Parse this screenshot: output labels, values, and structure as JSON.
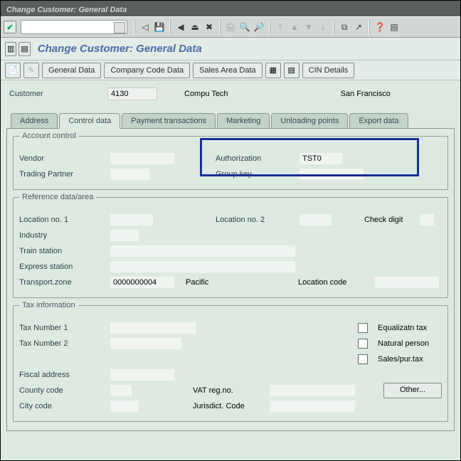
{
  "window": {
    "title": "Change Customer: General Data",
    "page_title": "Change Customer: General Data"
  },
  "toolbar": {
    "buttons": {
      "general_data": "General Data",
      "company_code_data": "Company Code Data",
      "sales_area_data": "Sales Area Data",
      "cin_details": "CIN Details"
    }
  },
  "header": {
    "customer_lbl": "Customer",
    "customer_id": "4130",
    "customer_name": "Compu Tech",
    "customer_city": "San Francisco"
  },
  "tabs": {
    "address": "Address",
    "control_data": "Control data",
    "payment_transactions": "Payment transactions",
    "marketing": "Marketing",
    "unloading_points": "Unloading points",
    "export_data": "Export data"
  },
  "groups": {
    "account_control": {
      "title": "Account control",
      "vendor": "Vendor",
      "trading_partner": "Trading Partner",
      "authorization": "Authorization",
      "authorization_val": "TST0",
      "group_key": "Group key"
    },
    "reference": {
      "title": "Reference data/area",
      "location1": "Location no. 1",
      "location2": "Location no. 2",
      "check_digit": "Check digit",
      "industry": "Industry",
      "train_station": "Train station",
      "express_station": "Express station",
      "transport_zone": "Transport.zone",
      "transport_zone_val": "0000000004",
      "transport_zone_desc": "Pacific",
      "location_code": "Location code"
    },
    "tax": {
      "title": "Tax information",
      "tax1": "Tax Number 1",
      "tax2": "Tax Number 2",
      "equalizatn": "Equalizatn tax",
      "natural": "Natural person",
      "salespur": "Sales/pur.tax",
      "fiscal": "Fiscal address",
      "county": "County code",
      "vatreg": "VAT reg.no.",
      "other": "Other...",
      "city": "City code",
      "jurisdict": "Jurisdict. Code"
    }
  }
}
